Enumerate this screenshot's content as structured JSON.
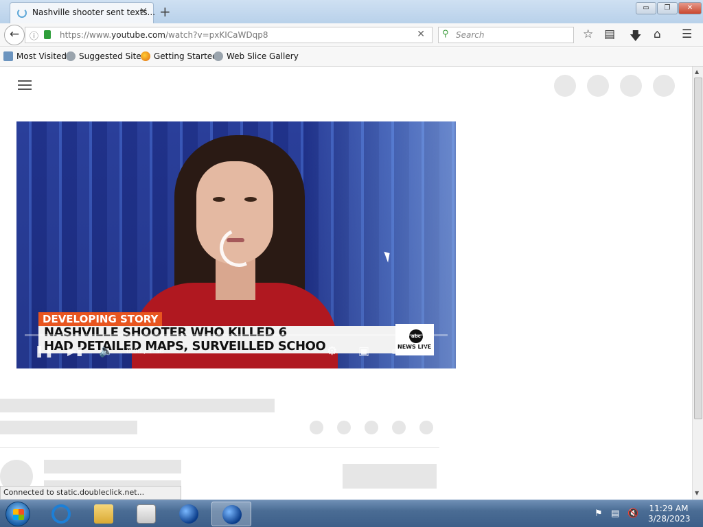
{
  "browser": {
    "tab_title": "Nashville shooter sent texts...",
    "tab_close": "✕",
    "new_tab": "+",
    "window_buttons": {
      "minimize": "▭",
      "restore": "❐",
      "close": "✕"
    },
    "url_host_prefix": "https://www.",
    "url_host": "youtube.com",
    "url_path": "/watch?v=pxKICaWDqp8",
    "url_clear": "✕",
    "search_placeholder": "Search",
    "bookmarks": [
      "Most Visited",
      "Suggested Sites",
      "Getting Started",
      "Web Slice Gallery"
    ],
    "status_text": "Connected to static.doubleclick.net..."
  },
  "video": {
    "tag": "DEVELOPING STORY",
    "headline_line1": "NASHVILLE SHOOTER WHO KILLED 6",
    "headline_line2": "HAD DETAILED MAPS, SURVEILLED SCHOO",
    "logo": "abc",
    "logo_sub": "NEWS LIVE",
    "time": "0:00 / 1:36",
    "colors": {
      "tag": "#e8551f",
      "background": "#1e2f86",
      "anchor_top": "#b01820"
    }
  },
  "taskbar": {
    "time": "11:29 AM",
    "date": "3/28/2023"
  },
  "icons": [
    "back-arrow-icon",
    "info-icon",
    "lock-icon",
    "search-icon",
    "star-icon",
    "reading-list-icon",
    "download-icon",
    "home-icon",
    "menu-icon",
    "hamburger-icon",
    "play-pause-icon",
    "next-icon",
    "volume-icon",
    "settings-icon",
    "miniplayer-icon",
    "theater-icon",
    "fullscreen-icon",
    "windows-start-icon",
    "ie-icon",
    "folder-icon",
    "media-player-icon",
    "globe-icon",
    "flag-icon",
    "network-icon",
    "speaker-muted-icon"
  ]
}
